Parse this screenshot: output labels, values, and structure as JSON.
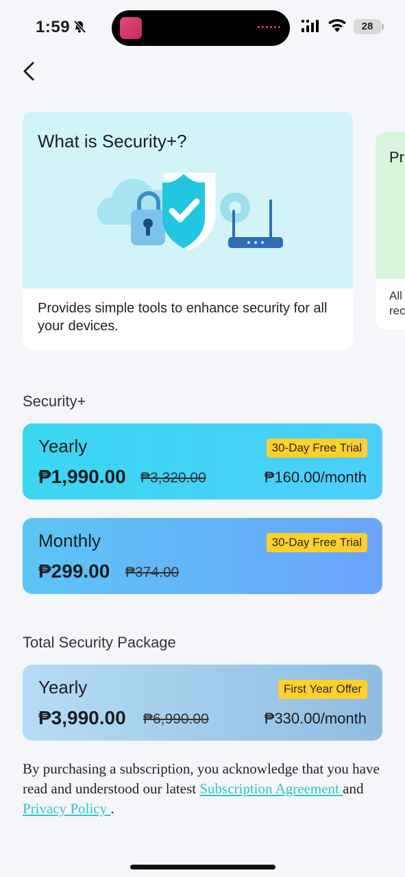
{
  "status": {
    "time": "1:59",
    "battery": "28"
  },
  "info_cards": [
    {
      "title": "What is Security+?",
      "description": "Provides simple tools to enhance security for all your devices."
    },
    {
      "title": "Pr",
      "description_lines": [
        "All",
        "rec"
      ]
    }
  ],
  "sections": [
    {
      "title": "Security+",
      "plans": [
        {
          "name": "Yearly",
          "badge": "30-Day Free Trial",
          "price": "₱1,990.00",
          "old_price": "₱3,320.00",
          "per_month": "₱160.00/month"
        },
        {
          "name": "Monthly",
          "badge": "30-Day Free Trial",
          "price": "₱299.00",
          "old_price": "₱374.00"
        }
      ]
    },
    {
      "title": "Total Security Package",
      "plans": [
        {
          "name": "Yearly",
          "badge": "First Year Offer",
          "price": "₱3,990.00",
          "old_price": "₱6,990.00",
          "per_month": "₱330.00/month"
        }
      ]
    }
  ],
  "legal": {
    "prefix": "By purchasing a subscription, you acknowledge that you have read and understood our latest ",
    "subscription_link": "Subscription Agreement ",
    "middle": "and ",
    "privacy_link": "Privacy Policy ",
    "suffix": "."
  },
  "colors": {
    "accent_link": "#2ec4c6",
    "badge": "#ffcf2e"
  }
}
